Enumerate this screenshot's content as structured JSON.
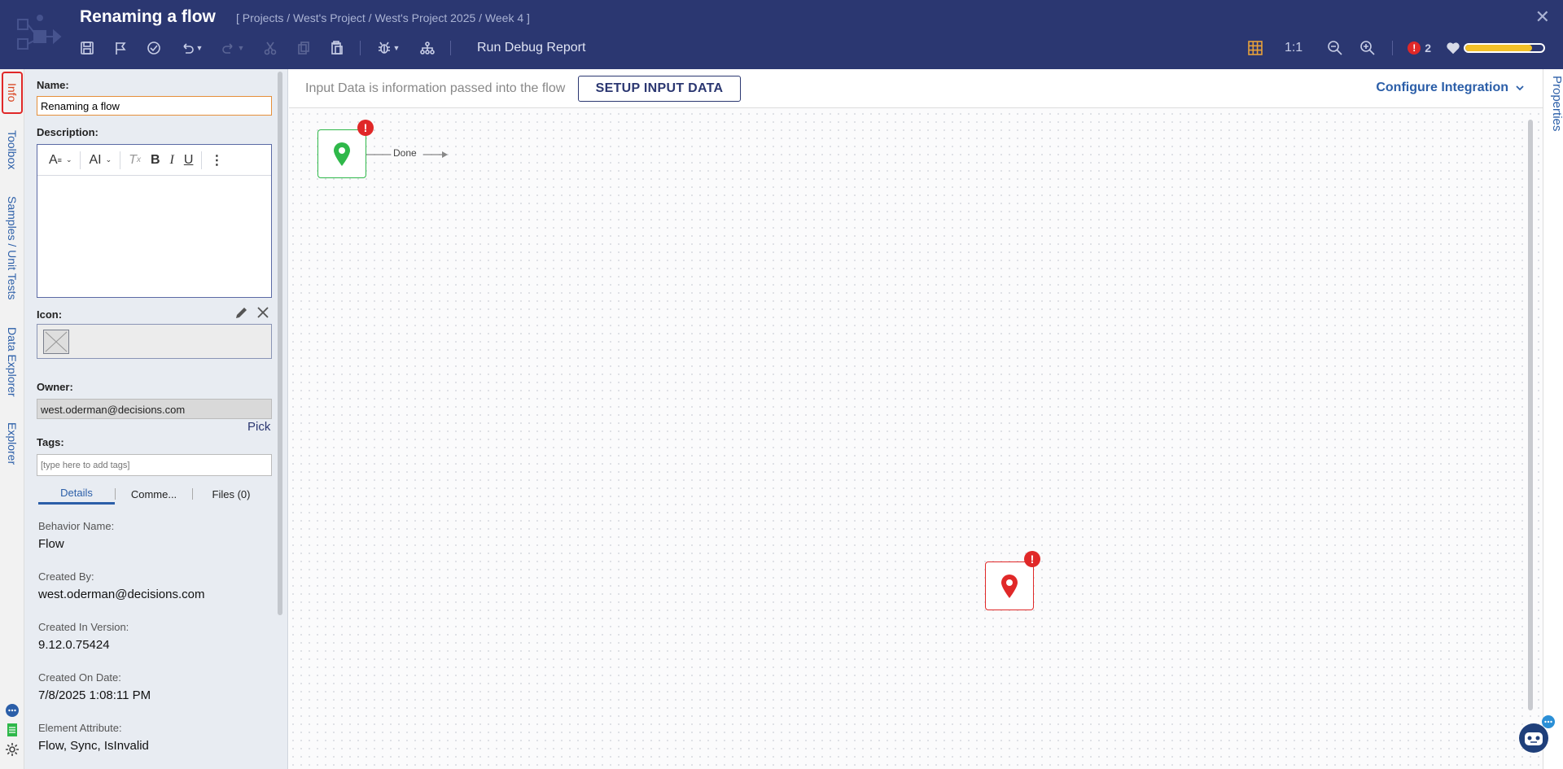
{
  "header": {
    "title": "Renaming a flow",
    "breadcrumb": "[ Projects / West's Project / West's Project 2025 / Week 4 ]",
    "run_debug_label": "Run Debug Report",
    "zoom_label": "1:1",
    "error_count": "2",
    "health_level": 0.85,
    "colors": {
      "background": "#2b3771",
      "health": "#f2c028",
      "error": "#e02828"
    }
  },
  "left_rail": {
    "tabs": [
      "Info",
      "Toolbox",
      "Samples / Unit Tests",
      "Data Explorer",
      "Explorer"
    ]
  },
  "info": {
    "name_label": "Name:",
    "name_value": "Renaming a flow",
    "description_label": "Description:",
    "icon_label": "Icon:",
    "owner_label": "Owner:",
    "owner_value": "west.oderman@decisions.com",
    "pick_label": "Pick",
    "tags_label": "Tags:",
    "tags_placeholder": "[type here to add tags]",
    "tabs": [
      "Details",
      "Comme...",
      "Files (0)"
    ],
    "details": [
      {
        "label": "Behavior Name:",
        "value": "Flow"
      },
      {
        "label": "Created By:",
        "value": "west.oderman@decisions.com"
      },
      {
        "label": "Created In Version:",
        "value": "9.12.0.75424"
      },
      {
        "label": "Created On Date:",
        "value": "7/8/2025 1:08:11 PM"
      },
      {
        "label": "Element Attribute:",
        "value": "Flow, Sync, IsInvalid"
      }
    ]
  },
  "canvas": {
    "input_message": "Input Data is information passed into the flow",
    "setup_button": "SETUP INPUT DATA",
    "configure_integration": "Configure Integration",
    "connector_label": "Done"
  },
  "right_rail": {
    "properties_label": "Properties"
  }
}
